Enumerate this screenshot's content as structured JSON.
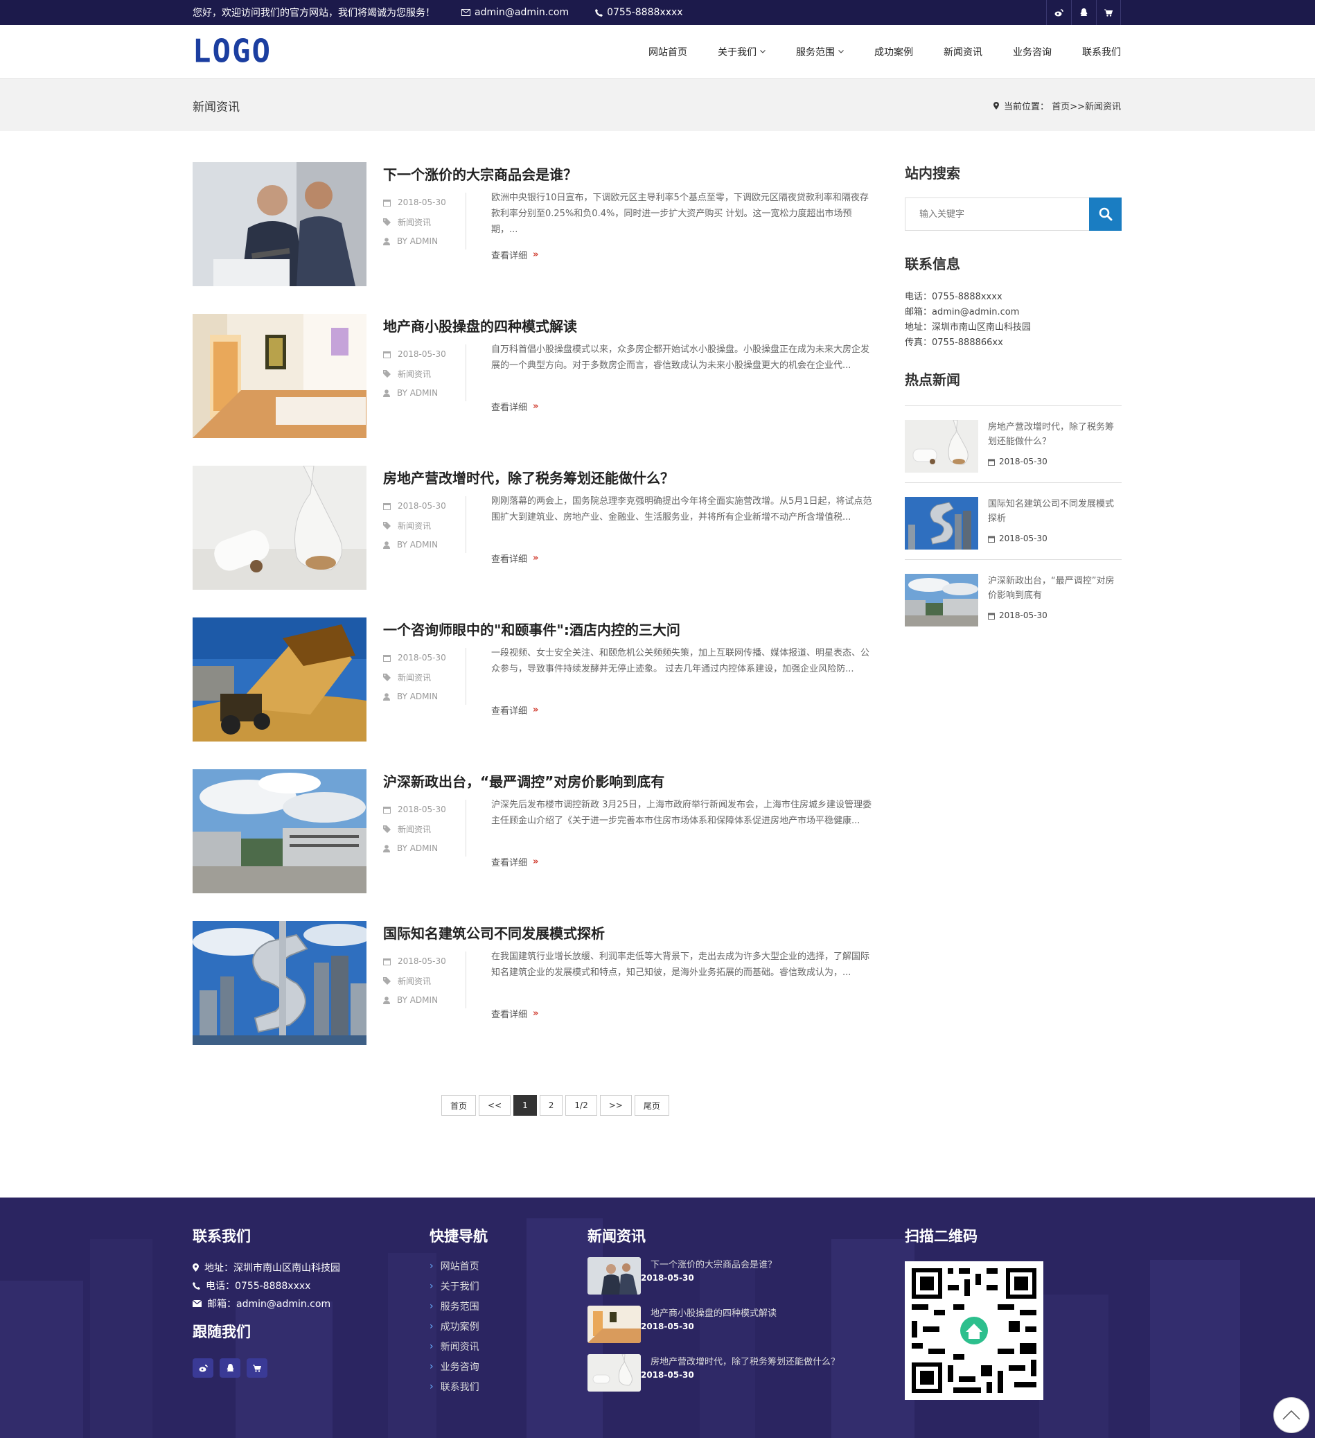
{
  "topbar": {
    "welcome": "您好，欢迎访问我们的官方网站，我们将竭诚为您服务！",
    "email": "admin@admin.com",
    "phone": "0755-8888xxxx",
    "icons": [
      "weibo-icon",
      "qq-icon",
      "cart-icon"
    ]
  },
  "header": {
    "logo": "LOGO",
    "nav": [
      "网站首页",
      "关于我们",
      "服务范围",
      "成功案例",
      "新闻资讯",
      "业务咨询",
      "联系我们"
    ]
  },
  "banner": {
    "title": "新闻资讯",
    "crumb_label": "当前位置：",
    "crumb_path": "首页>>新闻资讯"
  },
  "articles": [
    {
      "title": "下一个涨价的大宗商品会是谁？",
      "date": "2018-05-30",
      "category": "新闻资讯",
      "author": "BY ADMIN",
      "desc": "欧洲中央银行10日宣布，下调欧元区主导利率5个基点至零，下调欧元区隔夜贷款利率和隔夜存款利率分别至0.25%和负0.4%，同时进一步扩大资产购买 计划。这一宽松力度超出市场预期，...",
      "more": "查看详细"
    },
    {
      "title": "地产商小股操盘的四种模式解读",
      "date": "2018-05-30",
      "category": "新闻资讯",
      "author": "BY ADMIN",
      "desc": "自万科首倡小股操盘模式以来，众多房企都开始试水小股操盘。小股操盘正在成为未来大房企发展的一个典型方向。对于多数房企而言，睿信致成认为未来小股操盘更大的机会在企业代...",
      "more": "查看详细"
    },
    {
      "title": "房地产营改增时代，除了税务筹划还能做什么？",
      "date": "2018-05-30",
      "category": "新闻资讯",
      "author": "BY ADMIN",
      "desc": "刚刚落幕的两会上，国务院总理李克强明确提出今年将全面实施营改增。从5月1日起，将试点范围扩大到建筑业、房地产业、金融业、生活服务业，并将所有企业新增不动产所含增值税...",
      "more": "查看详细"
    },
    {
      "title": "一个咨询师眼中的\"和颐事件\":酒店内控的三大问",
      "date": "2018-05-30",
      "category": "新闻资讯",
      "author": "BY ADMIN",
      "desc": "一段视频、女士安全关注、和颐危机公关频频失策，加上互联网传播、媒体报道、明星表态、公众参与，导致事件持续发酵并无停止迹象。 过去几年通过内控体系建设，加强企业风险防...",
      "more": "查看详细"
    },
    {
      "title": "沪深新政出台，“最严调控”对房价影响到底有",
      "date": "2018-05-30",
      "category": "新闻资讯",
      "author": "BY ADMIN",
      "desc": "沪深先后发布楼市调控新政 3月25日，上海市政府举行新闻发布会，上海市住房城乡建设管理委主任顾金山介绍了《关于进一步完善本市住房市场体系和保障体系促进房地产市场平稳健康...",
      "more": "查看详细"
    },
    {
      "title": "国际知名建筑公司不同发展模式探析",
      "date": "2018-05-30",
      "category": "新闻资讯",
      "author": "BY ADMIN",
      "desc": "在我国建筑行业增长放缓、利润率走低等大背景下，走出去成为许多大型企业的选择，了解国际知名建筑企业的发展模式和特点，知己知彼，是海外业务拓展的而基础。睿信致成认为，...",
      "more": "查看详细"
    }
  ],
  "pager": [
    "首页",
    "<<",
    "1",
    "2",
    "1/2",
    ">>",
    "尾页"
  ],
  "sidebar": {
    "search_title": "站内搜索",
    "search_placeholder": "输入关键字",
    "contact_title": "联系信息",
    "contact": [
      "电话：0755-8888xxxx",
      "邮箱：admin@admin.com",
      "地址：深圳市南山区南山科技园",
      "传真：0755-888866xx"
    ],
    "hot_title": "热点新闻",
    "hot": [
      {
        "title": "房地产营改增时代，除了税务筹划还能做什么？",
        "date": "2018-05-30"
      },
      {
        "title": "国际知名建筑公司不同发展模式探析",
        "date": "2018-05-30"
      },
      {
        "title": "沪深新政出台，“最严调控”对房价影响到底有",
        "date": "2018-05-30"
      }
    ]
  },
  "footer": {
    "contact_title": "联系我们",
    "address": "地址：深圳市南山区南山科技园",
    "phone": "电话：0755-8888xxxx",
    "email": "邮箱：admin@admin.com",
    "follow_title": "跟随我们",
    "nav_title": "快捷导航",
    "nav": [
      "网站首页",
      "关于我们",
      "服务范围",
      "成功案例",
      "新闻资讯",
      "业务咨询",
      "联系我们"
    ],
    "news_title": "新闻资讯",
    "news": [
      {
        "title": "下一个涨价的大宗商品会是谁？",
        "date": "2018-05-30"
      },
      {
        "title": "地产商小股操盘的四种模式解读",
        "date": "2018-05-30"
      },
      {
        "title": "房地产营改增时代，除了税务筹划还能做什么？",
        "date": "2018-05-30"
      }
    ],
    "qr_title": "扫描二维码"
  },
  "colors": {
    "topbar": "#1c1a4b",
    "accent": "#1a7dc2",
    "footer": "#2a2460",
    "arrow": "#d03b2e"
  }
}
